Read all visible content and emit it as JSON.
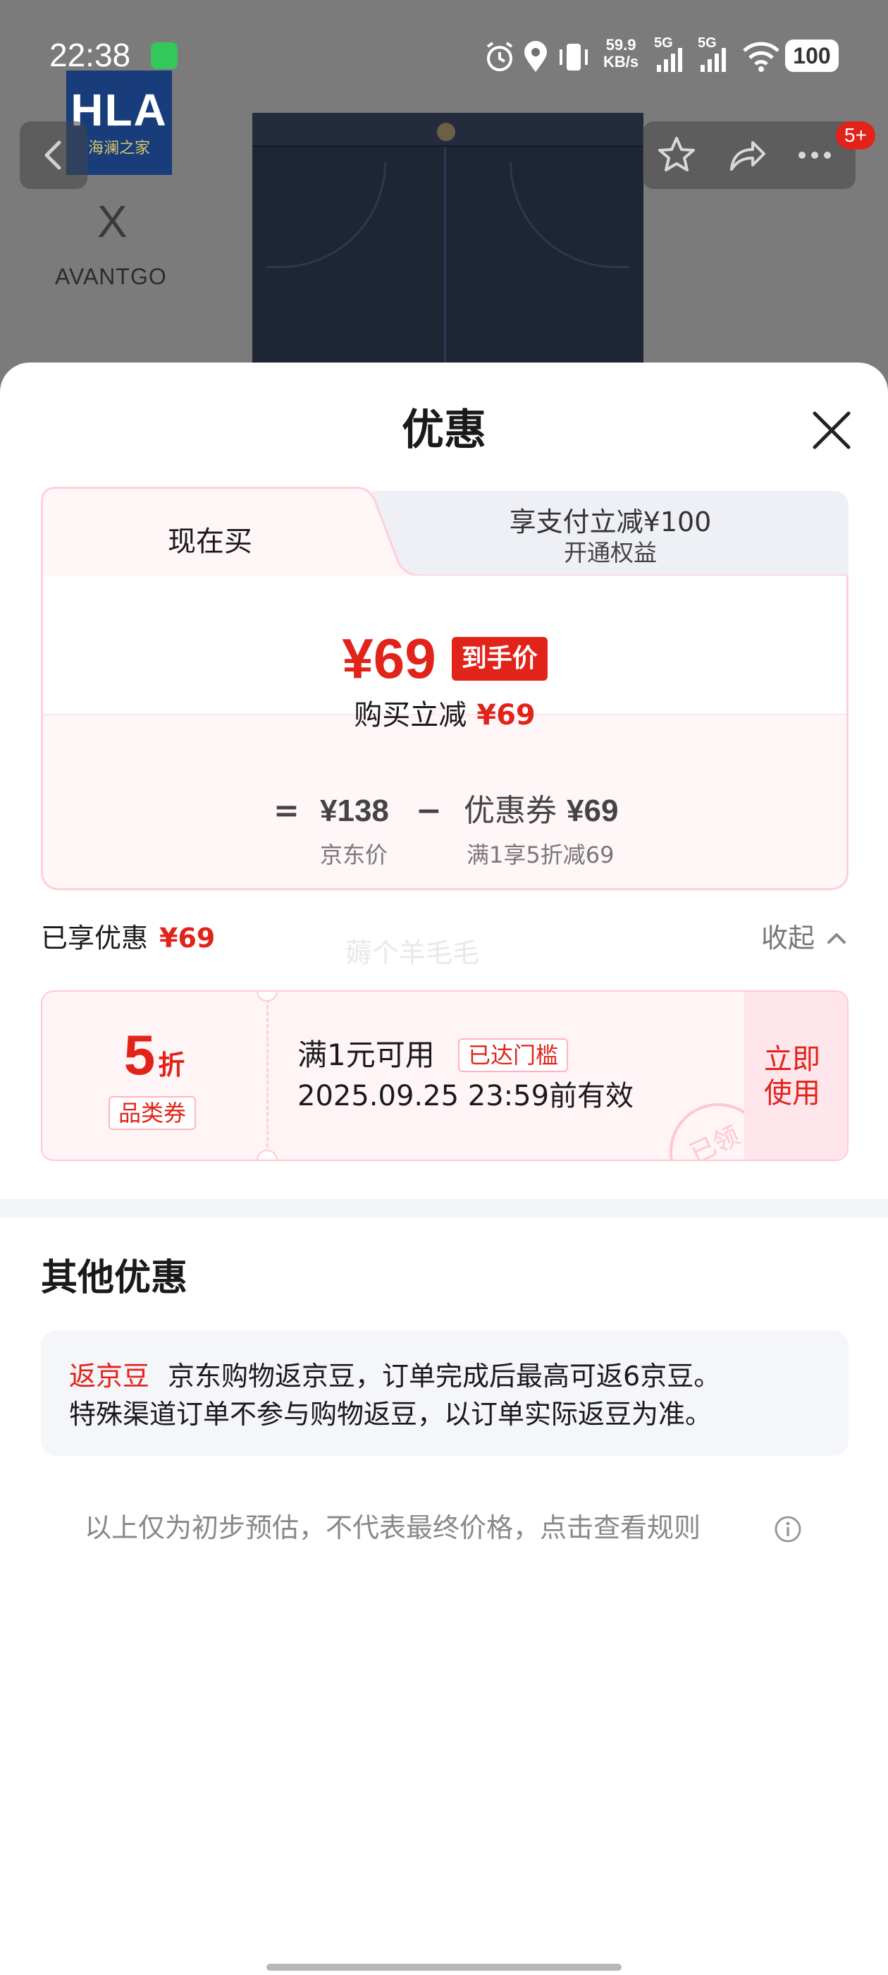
{
  "status_bar": {
    "time": "22:38",
    "net_speed_value": "59.9",
    "net_speed_unit": "KB/s",
    "sim1": "5G",
    "sim2": "5G",
    "battery": "100"
  },
  "background": {
    "logo_main": "HLA",
    "logo_sub": "海澜之家",
    "collab_mark": "X",
    "brand_name": "AVANTGO",
    "more_badge": "5+"
  },
  "sheet": {
    "title": "优惠",
    "tabs": {
      "active": "现在买",
      "inactive_main": "享支付立减¥100",
      "inactive_sub": "开通权益"
    },
    "final_price": "¥69",
    "final_tag": "到手价",
    "reduce_label": "购买立减",
    "reduce_value": "¥69",
    "formula": {
      "equals": "=",
      "jd_price": "¥138",
      "minus": "−",
      "coupon_label": "优惠券",
      "coupon_value": "¥69",
      "jd_price_label": "京东价",
      "coupon_rule": "满1享5折减69"
    },
    "enjoyed_label": "已享优惠",
    "enjoyed_value": "¥69",
    "watermark": "薅个羊毛毛",
    "collapse_label": "收起",
    "coupon": {
      "discount_num": "5",
      "discount_unit": "折",
      "category": "品类券",
      "condition": "满1元可用",
      "reached_tag": "已达门槛",
      "valid_until": "2025.09.25 23:59前有效",
      "stamp": "已领",
      "use_label": "立即使用"
    },
    "other_title": "其他优惠",
    "bean": {
      "label": "返京豆",
      "line1": "京东购物返京豆，订单完成后最高可返6京豆。",
      "line2": "特殊渠道订单不参与购物返豆，以订单实际返豆为准。"
    },
    "disclaimer": "以上仅为初步预估，不代表最终价格，点击查看规则"
  },
  "colors": {
    "accent_red": "#e2231a",
    "coupon_border": "#ffc9d2",
    "coupon_bg": "#fff4f6"
  }
}
